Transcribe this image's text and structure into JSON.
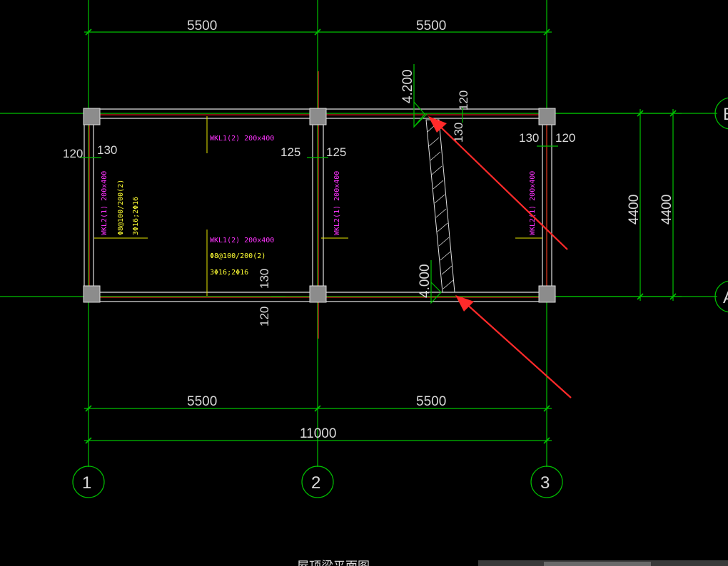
{
  "drawing": {
    "dimensions": {
      "top_left_span": "5500",
      "top_right_span": "5500",
      "bottom_left_span": "5500",
      "bottom_right_span": "5500",
      "total_span": "11000",
      "right_inner_height": "4400",
      "right_outer_height": "4400",
      "left_wall_outer": "120",
      "left_wall_inner": "130",
      "mid_wall_left": "125",
      "mid_wall_right": "125",
      "right_wall_inner": "130",
      "right_wall_outer": "120",
      "top_stair_120": "120",
      "top_stair_130": "130",
      "bottom_mid_130": "130",
      "bottom_mid_120": "120"
    },
    "elevations": {
      "upper": "4.200",
      "lower": "4.000"
    },
    "axes": {
      "bottom": [
        "1",
        "2",
        "3"
      ],
      "right_top": "B",
      "right_bottom": "A"
    },
    "beams": {
      "wkl1_top": "WKL1(2) 200x400",
      "wkl1_mid": "WKL1(2) 200x400",
      "wkl1_stirrup": "Φ8@100/200(2)",
      "wkl1_bars": "3Φ16;2Φ16",
      "wkl2_left": "WKL2(1) 200x400",
      "wkl2_left_stirrup": "Φ8@100/200(2)",
      "wkl2_left_bars": "3Φ16;2Φ16",
      "wkl2_mid": "WKL2(1) 200x400",
      "wkl2_right": "WKL2(1) 200x400"
    },
    "title": "屋顶梁平面图",
    "colors": {
      "grid": "#00c000",
      "wall": "#e0e0e0",
      "beam_label": "#ff33ff",
      "rebar_label": "#ffff33",
      "annotation_arrow": "#ff2a2a"
    }
  }
}
